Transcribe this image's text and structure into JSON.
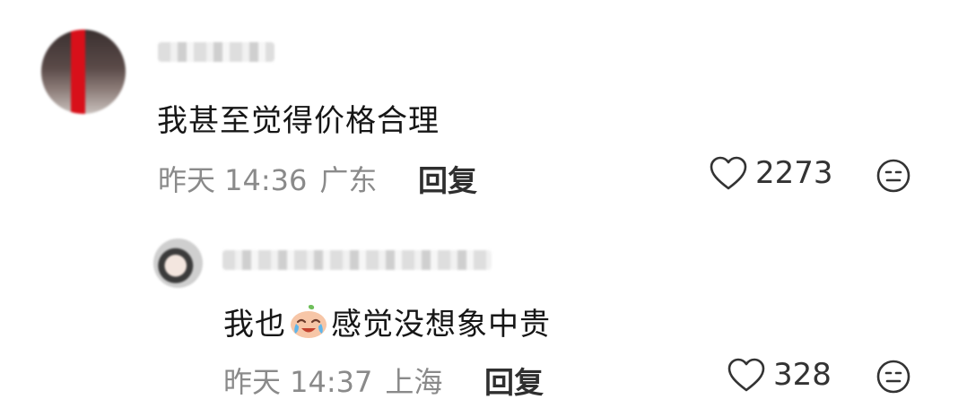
{
  "comment": {
    "text": "我甚至觉得价格合理",
    "time": "昨天 14:36",
    "location": "广东",
    "reply_label": "回复",
    "likes": "2273"
  },
  "reply": {
    "text_before": "我也",
    "text_after": "感觉没想象中贵",
    "time": "昨天 14:37",
    "location": "上海",
    "reply_label": "回复",
    "likes": "328"
  }
}
